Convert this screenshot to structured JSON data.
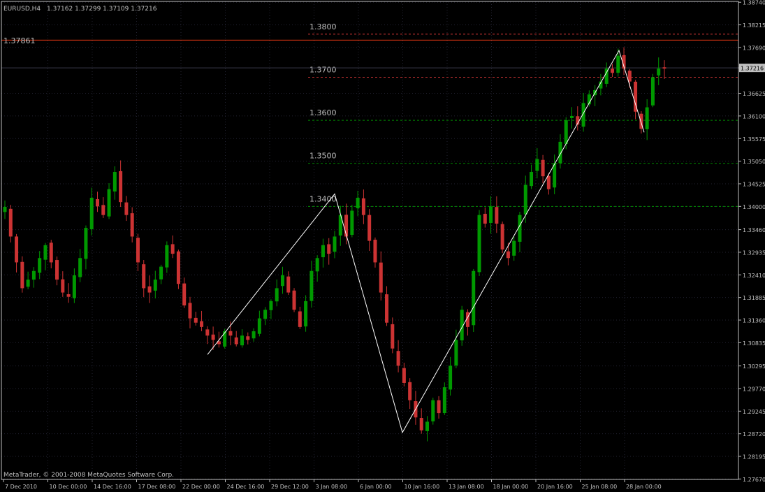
{
  "header": {
    "symbol": "EURUSD,H4",
    "ohlc": "1.37162 1.37299 1.37109 1.37216"
  },
  "footer": {
    "copyright": "MetaTrader, © 2001-2008 MetaQuotes Software Corp."
  },
  "colors": {
    "background": "#000000",
    "frame": "#c0c0c0",
    "grid": "#232332",
    "bull": "#009900",
    "bear": "#cc3333",
    "text": "#c0c0c0",
    "zigzag": "#ffffff",
    "level_red": "#cc3333",
    "level_green": "#008a00",
    "horizontal_line": "#ff3c14",
    "bid_line": "#3a3a4a",
    "price_tag_bg": "#c0c0c0",
    "price_tag_text": "#000000"
  },
  "chart_data": {
    "type": "candlestick",
    "symbol": "EURUSD",
    "timeframe": "H4",
    "ylim": [
      1.2766,
      1.3876
    ],
    "y_ticks": [
      "1.38740",
      "1.38215",
      "1.37690",
      "1.37216",
      "1.36625",
      "1.36100",
      "1.35575",
      "1.35050",
      "1.34525",
      "1.34000",
      "1.33460",
      "1.32935",
      "1.32410",
      "1.31885",
      "1.31360",
      "1.30835",
      "1.30295",
      "1.29770",
      "1.29245",
      "1.28720",
      "1.28195",
      "1.27670"
    ],
    "x_ticks": [
      "7 Dec 2010",
      "10 Dec 00:00",
      "14 Dec 16:00",
      "17 Dec 08:00",
      "22 Dec 00:00",
      "24 Dec 16:00",
      "29 Dec 12:00",
      "3 Jan 08:00",
      "6 Jan 00:00",
      "10 Jan 16:00",
      "13 Jan 08:00",
      "18 Jan 00:00",
      "20 Jan 16:00",
      "25 Jan 08:00",
      "28 Jan 00:00"
    ],
    "grid": true,
    "current_price": 1.37216,
    "horizontal_line": 1.37861,
    "horizontal_line_label": "1.37861",
    "levels": [
      {
        "label": "1.3800",
        "value": 1.38,
        "color": "red"
      },
      {
        "label": "1.3700",
        "value": 1.37,
        "color": "red"
      },
      {
        "label": "1.3600",
        "value": 1.36,
        "color": "green"
      },
      {
        "label": "1.3500",
        "value": 1.35,
        "color": "green"
      },
      {
        "label": "1.3400",
        "value": 1.34,
        "color": "green"
      }
    ],
    "zigzag": [
      {
        "date": "22 Dec 2010 16:00",
        "price": 1.3056
      },
      {
        "date": "3 Jan 2011 16:00",
        "price": 1.3429
      },
      {
        "date": "10 Jan 2011 00:00",
        "price": 1.2875
      },
      {
        "date": "25 Jan 2011 20:00",
        "price": 1.3762
      },
      {
        "date": "28 Jan 2011 00:00",
        "price": 1.3572
      }
    ],
    "closes": [
      1.3399,
      1.333,
      1.327,
      1.321,
      1.323,
      1.325,
      1.328,
      1.331,
      1.327,
      1.323,
      1.32,
      1.319,
      1.324,
      1.328,
      1.335,
      1.342,
      1.34,
      1.338,
      1.344,
      1.348,
      1.341,
      1.338,
      1.333,
      1.327,
      1.321,
      1.32,
      1.323,
      1.326,
      1.331,
      1.329,
      1.322,
      1.317,
      1.314,
      1.313,
      1.312,
      1.31,
      1.309,
      1.308,
      1.311,
      1.31,
      1.308,
      1.31,
      1.309,
      1.311,
      1.314,
      1.316,
      1.318,
      1.321,
      1.324,
      1.32,
      1.316,
      1.312,
      1.318,
      1.325,
      1.328,
      1.331,
      1.329,
      1.333,
      1.338,
      1.333,
      1.339,
      1.342,
      1.338,
      1.332,
      1.327,
      1.32,
      1.313,
      1.307,
      1.303,
      1.299,
      1.295,
      1.291,
      1.288,
      1.29,
      1.295,
      1.292,
      1.298,
      1.303,
      1.309,
      1.316,
      1.312,
      1.325,
      1.338,
      1.336,
      1.34,
      1.336,
      1.33,
      1.328,
      1.332,
      1.338,
      1.345,
      1.348,
      1.351,
      1.347,
      1.344,
      1.35,
      1.355,
      1.36,
      1.361,
      1.359,
      1.364,
      1.366,
      1.367,
      1.369,
      1.372,
      1.371,
      1.375,
      1.372,
      1.369,
      1.362,
      1.358,
      1.363,
      1.37,
      1.372,
      1.372
    ]
  }
}
